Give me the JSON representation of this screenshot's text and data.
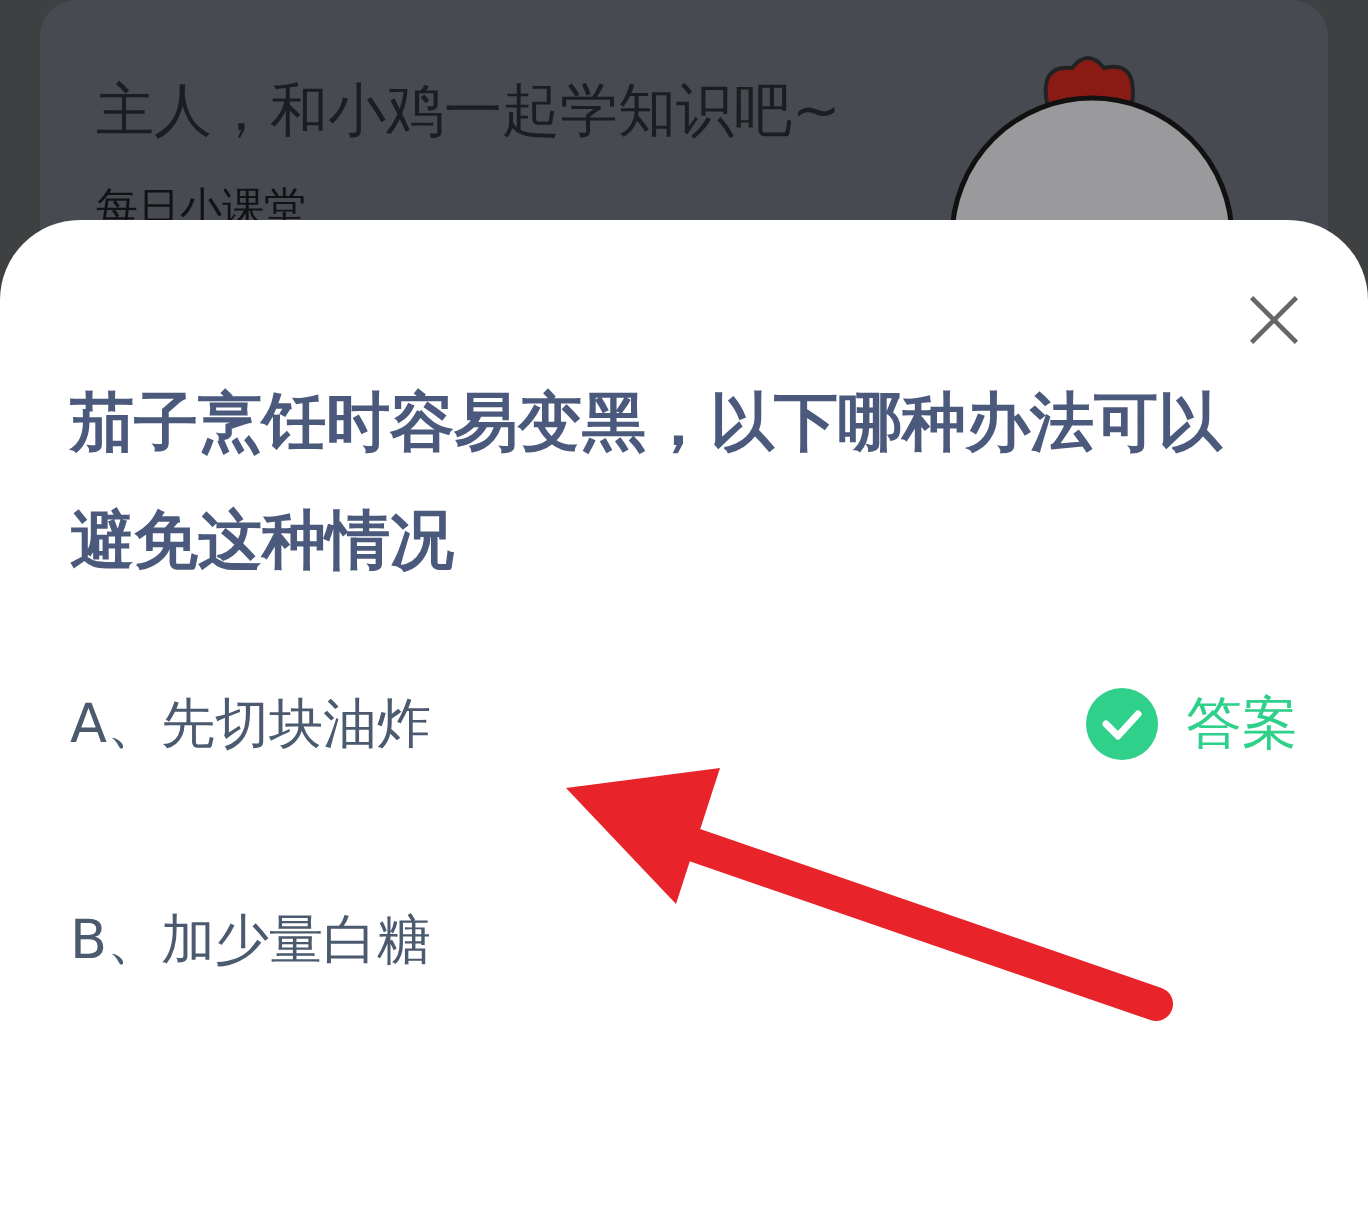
{
  "banner": {
    "title": "主人，和小鸡一起学知识吧~",
    "subtitle": "每日小课堂"
  },
  "quiz": {
    "question": "茄子烹饪时容易变黑，以下哪种办法可以避免这种情况",
    "answer_label": "答案",
    "options": [
      {
        "label": "A、先切块油炸",
        "correct": true
      },
      {
        "label": "B、加少量白糖",
        "correct": false
      }
    ]
  }
}
